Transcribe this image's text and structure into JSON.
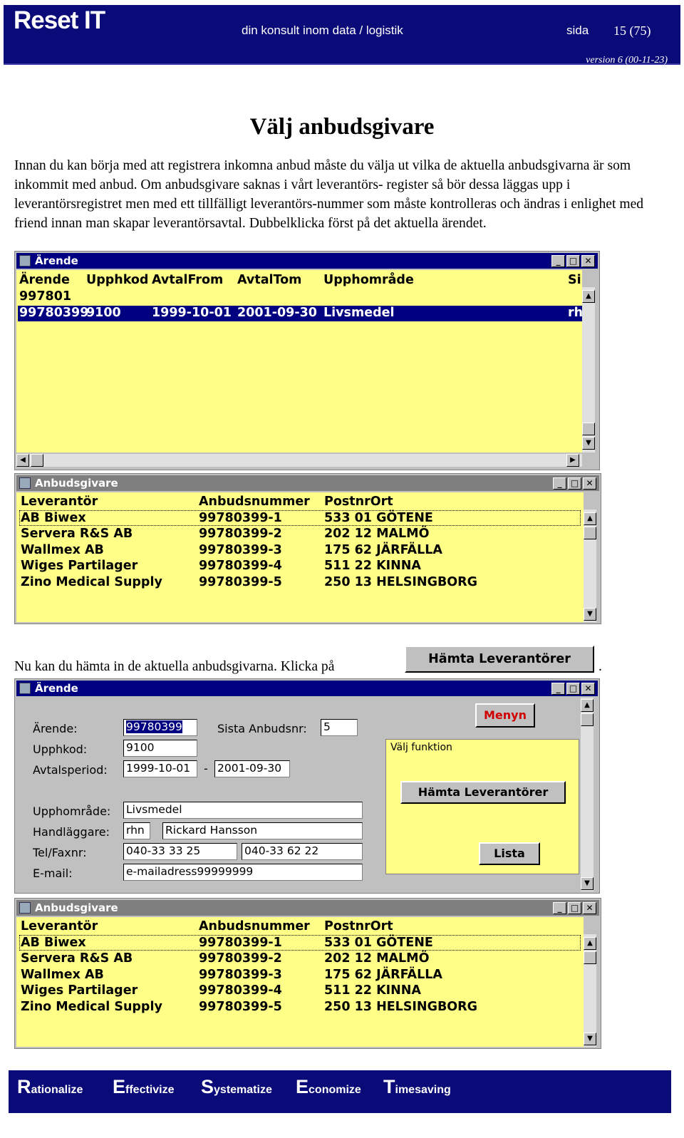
{
  "header": {
    "logo": "Reset IT",
    "tagline": "din konsult inom data / logistik",
    "sida_label": "sida",
    "page": "15  (75)",
    "version": "version 6 (00-11-23)"
  },
  "title": "Välj anbudsgivare",
  "intro": "Innan du kan börja med att registrera inkomna anbud måste du välja ut vilka de aktuella anbudsgivarna är som inkommit med anbud. Om anbudsgivare saknas i vårt leverantörs- register så bör dessa läggas upp i leverantörsregistret men med ett tillfälligt leverantörs-nummer som måste kontrolleras och ändras i enlighet med friend innan man skapar leverantörsavtal. Dubbelklicka först på det aktuella ärendet.",
  "line2": "Nu kan du hämta in de aktuella anbudsgivarna. Klicka på",
  "line2_end": ".",
  "inline_button": "Hämta Leverantörer",
  "arende_list": {
    "title": "Ärende",
    "headers": [
      "Ärende",
      "Upphkod",
      "AvtalFrom",
      "AvtalTom",
      "Upphområde",
      "Si"
    ],
    "rows": [
      {
        "arende": "997801",
        "kod": "",
        "from": "",
        "tom": "",
        "omr": "",
        "si": ""
      },
      {
        "arende": "99780399",
        "kod": "9100",
        "from": "1999-10-01",
        "tom": "2001-09-30",
        "omr": "Livsmedel",
        "si": "rh"
      }
    ]
  },
  "anbud_list": {
    "title": "Anbudsgivare",
    "headers": [
      "Leverantör",
      "Anbudsnummer",
      "PostnrOrt"
    ],
    "rows": [
      {
        "lev": "AB Biwex",
        "nr": "99780399-1",
        "ort": "533 01  GÖTENE"
      },
      {
        "lev": "Servera R&S AB",
        "nr": "99780399-2",
        "ort": "202 12  MALMÖ"
      },
      {
        "lev": "Wallmex AB",
        "nr": "99780399-3",
        "ort": "175 62  JÄRFÄLLA"
      },
      {
        "lev": "Wiges Partilager",
        "nr": "99780399-4",
        "ort": "511 22  KINNA"
      },
      {
        "lev": "Zino Medical Supply",
        "nr": "99780399-5",
        "ort": "250 13  HELSINGBORG"
      }
    ]
  },
  "arende_form": {
    "title": "Ärende",
    "labels": {
      "arende": "Ärende:",
      "sista": "Sista Anbudsnr:",
      "upphkod": "Upphkod:",
      "avtal": "Avtalsperiod:",
      "dash": "-",
      "omrade": "Upphområde:",
      "handl": "Handläggare:",
      "tel": "Tel/Faxnr:",
      "email": "E-mail:"
    },
    "values": {
      "arende": "99780399",
      "sista": "5",
      "upphkod": "9100",
      "from": "1999-10-01",
      "tom": "2001-09-30",
      "omrade": "Livsmedel",
      "handl_kort": "rhn",
      "handl_namn": "Rickard Hansson",
      "tel": "040-33 33 25",
      "fax": "040-33 62 22",
      "email": "e-mailadress99999999"
    },
    "group_title": "Välj funktion",
    "buttons": {
      "menyn": "Menyn",
      "hamta": "Hämta Leverantörer",
      "lista": "Lista"
    }
  },
  "footer": [
    {
      "cap": "R",
      "rest": "ationalize"
    },
    {
      "cap": "E",
      "rest": "ffectivize"
    },
    {
      "cap": "S",
      "rest": "ystematize"
    },
    {
      "cap": "E",
      "rest": "conomize"
    },
    {
      "cap": "T",
      "rest": "imesaving"
    }
  ],
  "colors": {
    "navy": "#0a0a78",
    "yellow": "#ffff88",
    "titlebar": "#000080",
    "menyn_text": "#d00000"
  }
}
